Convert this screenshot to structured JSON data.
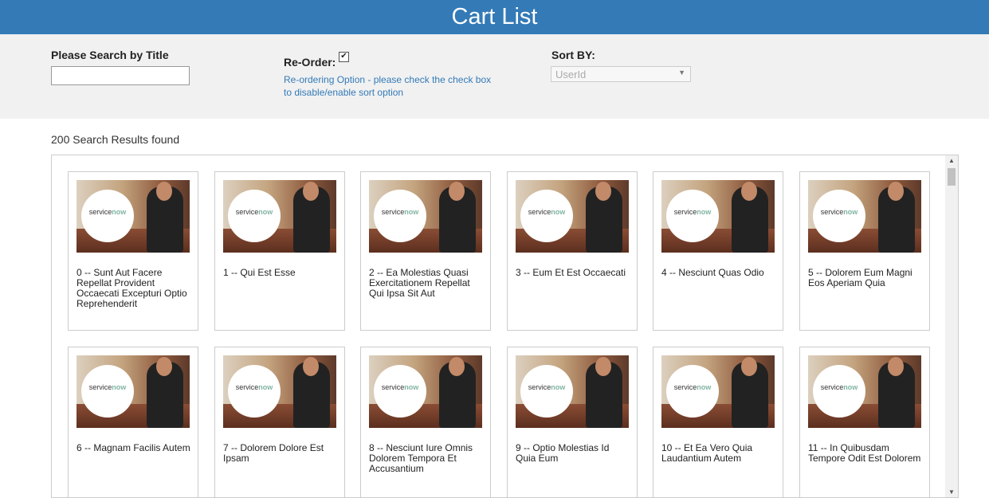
{
  "header": {
    "title": "Cart List"
  },
  "filters": {
    "search_label": "Please Search by Title",
    "search_value": "",
    "reorder_label": "Re-Order:",
    "reorder_checked": true,
    "reorder_check_glyph": "✔",
    "reorder_help": "Re-ordering Option - please check the check box to disable/enable sort option",
    "sort_label": "Sort BY:",
    "sort_value": "UserId"
  },
  "results": {
    "count_text": "200 Search Results found",
    "logo": {
      "text_plain": "service",
      "text_accent": "now"
    },
    "items": [
      {
        "title": "0 -- Sunt Aut Facere Repellat Provident Occaecati Excepturi Optio Reprehenderit"
      },
      {
        "title": "1 -- Qui Est Esse"
      },
      {
        "title": "2 -- Ea Molestias Quasi Exercitationem Repellat Qui Ipsa Sit Aut"
      },
      {
        "title": "3 -- Eum Et Est Occaecati"
      },
      {
        "title": "4 -- Nesciunt Quas Odio"
      },
      {
        "title": "5 -- Dolorem Eum Magni Eos Aperiam Quia"
      },
      {
        "title": "6 -- Magnam Facilis Autem"
      },
      {
        "title": "7 -- Dolorem Dolore Est Ipsam"
      },
      {
        "title": "8 -- Nesciunt Iure Omnis Dolorem Tempora Et Accusantium"
      },
      {
        "title": "9 -- Optio Molestias Id Quia Eum"
      },
      {
        "title": "10 -- Et Ea Vero Quia Laudantium Autem"
      },
      {
        "title": "11 -- In Quibusdam Tempore Odit Est Dolorem"
      }
    ]
  },
  "scrollbar": {
    "up_icon": "▲",
    "down_icon": "▼"
  },
  "colors": {
    "header_bg": "#337ab7",
    "filter_bg": "#f1f1f1",
    "help_text": "#337ab7"
  }
}
